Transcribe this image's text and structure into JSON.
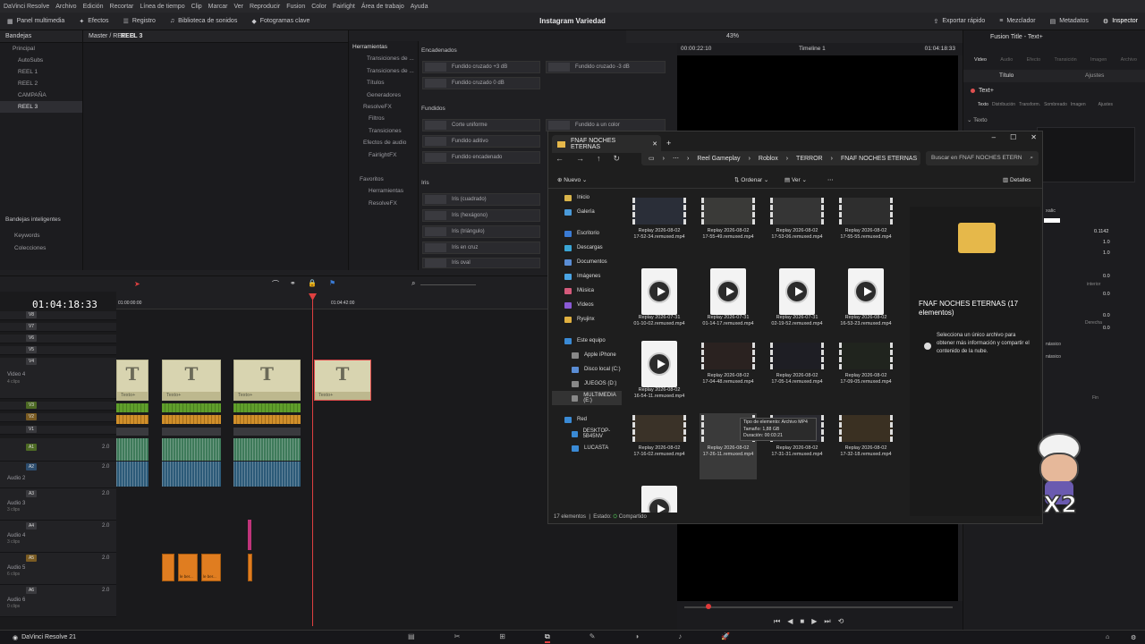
{
  "menu": [
    "DaVinci Resolve",
    "Archivo",
    "Edición",
    "Recortar",
    "Línea de tiempo",
    "Clip",
    "Marcar",
    "Ver",
    "Reproducir",
    "Fusion",
    "Color",
    "Fairlight",
    "Área de trabajo",
    "Ayuda"
  ],
  "toolbar": {
    "media_pool": "Panel multimedia",
    "effects": "Efectos",
    "edit_index": "Registro",
    "sound_library": "Biblioteca de sonidos",
    "keyframes": "Fotogramas clave",
    "project_title": "Instagram Variedad",
    "quick_export": "Exportar rápido",
    "mixer": "Mezclador",
    "metadata": "Metadatos",
    "inspector": "Inspector"
  },
  "bins": {
    "header": "Bandejas",
    "path": "REEL 3",
    "breadcrumb": "Master / REEL 3",
    "root": "Principal",
    "items": [
      "AutoSubs",
      "REEL 1",
      "REEL 2",
      "CAMPAÑA",
      "REEL 3"
    ],
    "smart_bins": "Bandejas inteligentes",
    "smart_items": [
      "Keywords",
      "Colecciones"
    ]
  },
  "fx_library": {
    "header": "Herramientas",
    "tree": [
      "Transiciones de ...",
      "Transiciones de ...",
      "Títulos",
      "Generadores",
      "ResolveFX",
      "Filtros",
      "Transiciones",
      "Efectos de audio",
      "FairlightFX"
    ],
    "favorites": "Favoritos",
    "fav_items": [
      "Herramientas",
      "ResolveFX"
    ],
    "sections": [
      "Encadenados",
      "Fundidos",
      "Iris"
    ],
    "tiles": [
      "Fundido cruzado +3 dB",
      "Fundido cruzado -3 dB",
      "Fundido cruzado 0 dB",
      "Corte uniforme",
      "Fundido a un color",
      "Fundido aditivo",
      "Fundido encadenado",
      "Iris (cuadrado)",
      "Iris (hexágono)",
      "Iris (triángulo)",
      "Iris en cruz",
      "Iris oval"
    ]
  },
  "viewer": {
    "timecode": "00:00:22:10",
    "zoom": "43%",
    "timeline_name": "Timeline 1",
    "end_timecode": "01:04:18:33"
  },
  "timeline": {
    "timecode": "01:04:18:33",
    "ruler": [
      "01:00:00:00",
      "01:04:42:00"
    ],
    "tracks_video": [
      "V8",
      "V7",
      "V6",
      "V5",
      "V4",
      "V3",
      "V2",
      "V1"
    ],
    "video4_name": "Video 4",
    "video4_sub": "4 clips",
    "tracks_audio": [
      "A1",
      "A2",
      "A3",
      "A4",
      "A5",
      "A6"
    ],
    "audio_names": [
      "Audio 2",
      "Audio 3",
      "Audio 4",
      "Audio 5",
      "Audio 6"
    ],
    "audio_subs": [
      "3 clips",
      "3 clips",
      "3 clips",
      "6 clips",
      "0 clips"
    ],
    "level": "2.0",
    "text_clip_label": "Texto+",
    "audio_clip_label": "le ber..."
  },
  "explorer": {
    "tab_title": "FNAF NOCHES ETERNAS",
    "path": [
      "Reel Gameplay",
      "Roblox",
      "TERROR",
      "FNAF NOCHES ETERNAS"
    ],
    "search_placeholder": "Buscar en FNAF NOCHES ETERN",
    "new_label": "Nuevo",
    "sort_label": "Ordenar",
    "view_label": "Ver",
    "details_label": "Detalles",
    "nav": [
      {
        "label": "Inicio",
        "color": "#d9b44a"
      },
      {
        "label": "Galería",
        "color": "#4a9ad9"
      },
      {
        "label": "Escritorio",
        "color": "#3a7bd5"
      },
      {
        "label": "Descargas",
        "color": "#3aa5d5"
      },
      {
        "label": "Documentos",
        "color": "#5a8dd5"
      },
      {
        "label": "Imágenes",
        "color": "#4aa5e5"
      },
      {
        "label": "Música",
        "color": "#d55a7b"
      },
      {
        "label": "Vídeos",
        "color": "#8a5ad5"
      },
      {
        "label": "Ryujinx",
        "color": "#e0b040"
      },
      {
        "label": "Este equipo",
        "color": "#3a8ad5"
      },
      {
        "label": "Apple iPhone",
        "color": "#888"
      },
      {
        "label": "Disco local (C:)",
        "color": "#5a8dd5"
      },
      {
        "label": "JUEGOS (D:)",
        "color": "#888"
      },
      {
        "label": "MULTIMEDIA (E:)",
        "color": "#888"
      },
      {
        "label": "Red",
        "color": "#3a8ad5"
      },
      {
        "label": "DESKTOP-5B45NV",
        "color": "#3a8ad5"
      },
      {
        "label": "LUCASTA",
        "color": "#3a8ad5"
      }
    ],
    "files": [
      {
        "l1": "Replay 2026-08-02",
        "l2": "17-52-34.remuxed.mp4",
        "kind": "video",
        "tone": "#2a2e38"
      },
      {
        "l1": "Replay 2026-08-02",
        "l2": "17-55-49.remuxed.mp4",
        "kind": "video",
        "tone": "#3a3a38"
      },
      {
        "l1": "Replay 2026-08-02",
        "l2": "17-53-06.remuxed.mp4",
        "kind": "video",
        "tone": "#353535"
      },
      {
        "l1": "Replay 2026-08-02",
        "l2": "17-55-55.remuxed.mp4",
        "kind": "video",
        "tone": "#2e2e2e"
      },
      {
        "l1": "Replay 2026-07-31",
        "l2": "01-10-02.remuxed.mp4",
        "kind": "doc",
        "tone": ""
      },
      {
        "l1": "Replay 2026-07-31",
        "l2": "01-14-17.remuxed.mp4",
        "kind": "doc",
        "tone": ""
      },
      {
        "l1": "Replay 2026-07-31",
        "l2": "02-19-52.remuxed.mp4",
        "kind": "doc",
        "tone": ""
      },
      {
        "l1": "Replay 2026-08-02",
        "l2": "16-53-23.remuxed.mp4",
        "kind": "doc",
        "tone": ""
      },
      {
        "l1": "Replay 2026-08-02",
        "l2": "16-54-11.remuxed.mp4",
        "kind": "doc",
        "tone": ""
      },
      {
        "l1": "Replay 2026-08-02",
        "l2": "17-04-48.remuxed.mp4",
        "kind": "video",
        "tone": "#2a2220"
      },
      {
        "l1": "Replay 2026-08-02",
        "l2": "17-05-14.remuxed.mp4",
        "kind": "video",
        "tone": "#1e1e24"
      },
      {
        "l1": "Replay 2026-08-02",
        "l2": "17-09-05.remuxed.mp4",
        "kind": "video",
        "tone": "#20241e"
      },
      {
        "l1": "Replay 2026-08-02",
        "l2": "17-16-02.remuxed.mp4",
        "kind": "video",
        "tone": "#3a3228"
      },
      {
        "l1": "Replay 2026-08-02",
        "l2": "17-26-11.remuxed.mp4",
        "kind": "video",
        "tone": "#3a3a3a"
      },
      {
        "l1": "Replay 2026-08-02",
        "l2": "17-31-31.remuxed.mp4",
        "kind": "video",
        "tone": "#2a2a30"
      },
      {
        "l1": "Replay 2026-08-02",
        "l2": "17-32-18.remuxed.mp4",
        "kind": "video",
        "tone": "#3a3022"
      },
      {
        "l1": "",
        "l2": "",
        "kind": "doc",
        "tone": ""
      }
    ],
    "tooltip": [
      "Tipo de elemento: Archivo MP4",
      "Tamaño: 1,88 GB",
      "Duración: 00:03:21"
    ],
    "detail_title": "FNAF NOCHES ETERNAS (17 elementos)",
    "detail_text": "Selecciona un único archivo para obtener más información y compartir el contenido de la nube.",
    "status_count": "17 elementos",
    "status_state": "Estado:",
    "status_shared": "Compartido"
  },
  "inspector": {
    "title": "Fusion Title - Text+",
    "tabs": [
      "Video",
      "Audio",
      "Efecto",
      "Transición",
      "Imagen",
      "Archivo"
    ],
    "subtabs": [
      "Título",
      "Ajustes"
    ],
    "node": "Text+",
    "node_tabs": [
      "Texto",
      "Distribución",
      "Transform.",
      "Sombreado",
      "Imagen",
      "Ajustes"
    ],
    "section": "Texto",
    "values": [
      "0.1142",
      "1.0",
      "1.0",
      "0.0",
      "0.0",
      "0.0",
      "0.0"
    ],
    "partial_labels": [
      "xalic",
      "interior",
      "Derecha",
      "nássico",
      "nássico",
      "Fin"
    ]
  },
  "bottom": {
    "app": "DaVinci Resolve 21"
  },
  "overlay_text": "X2"
}
